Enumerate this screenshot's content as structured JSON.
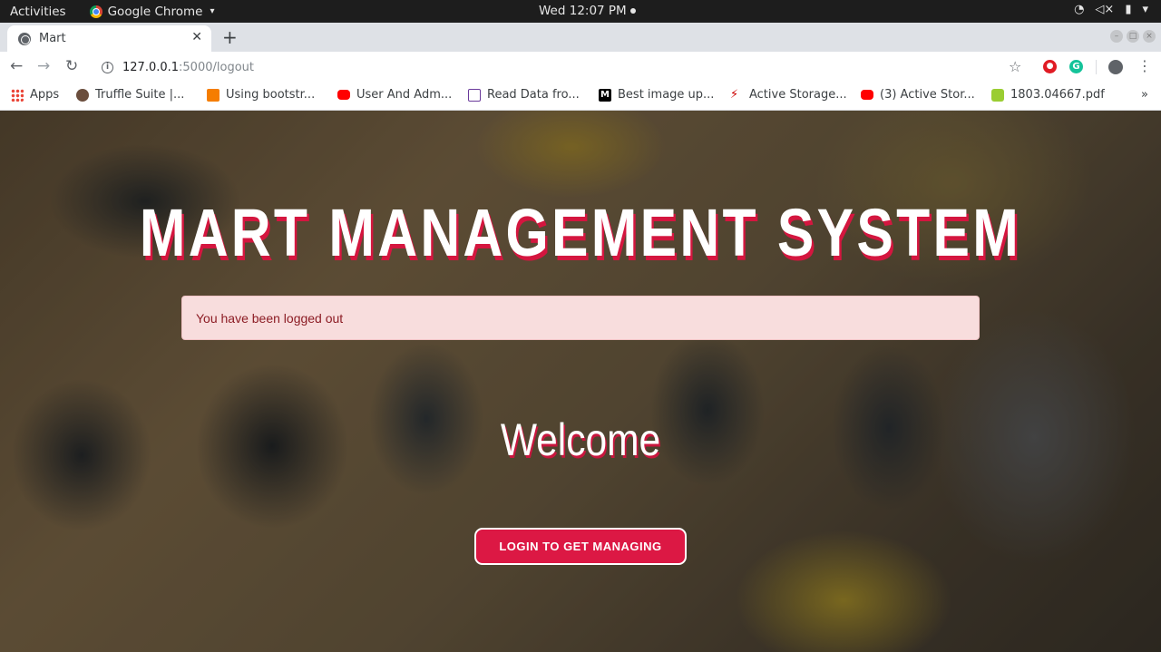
{
  "os_bar": {
    "activities": "Activities",
    "app_name": "Google Chrome",
    "clock": "Wed 12:07 PM"
  },
  "tab": {
    "title": "Mart"
  },
  "address_bar": {
    "host": "127.0.0.1",
    "path": ":5000/logout"
  },
  "bookmarks": [
    {
      "label": "Apps",
      "icon": "apps-grid-icon",
      "color": "#ea4335"
    },
    {
      "label": "Truffle Suite |...",
      "icon": "truffle-icon",
      "color": "#6b4e3d"
    },
    {
      "label": "Using bootstr...",
      "icon": "blogger-icon",
      "color": "#f57d00"
    },
    {
      "label": "User And Adm...",
      "icon": "youtube-icon",
      "color": "#ff0000"
    },
    {
      "label": "Read Data fro...",
      "icon": "document-icon",
      "color": "#6a3a9b"
    },
    {
      "label": "Best image up...",
      "icon": "medium-icon",
      "color": "#000000"
    },
    {
      "label": "Active Storage...",
      "icon": "rails-icon",
      "color": "#cc0000"
    },
    {
      "label": "(3) Active Stor...",
      "icon": "youtube-icon",
      "color": "#ff0000"
    },
    {
      "label": "1803.04667.pdf",
      "icon": "pdf-smiley-icon",
      "color": "#9acd32"
    }
  ],
  "bookmarks_more": "»",
  "page": {
    "title": "MART MANAGEMENT SYSTEM",
    "alert": "You have been logged out",
    "welcome": "Welcome",
    "login_button": "LOGIN TO GET MANAGING"
  },
  "colors": {
    "accent": "#dc1844",
    "alert_bg": "#f8dddd",
    "alert_text": "#8c1c24"
  }
}
